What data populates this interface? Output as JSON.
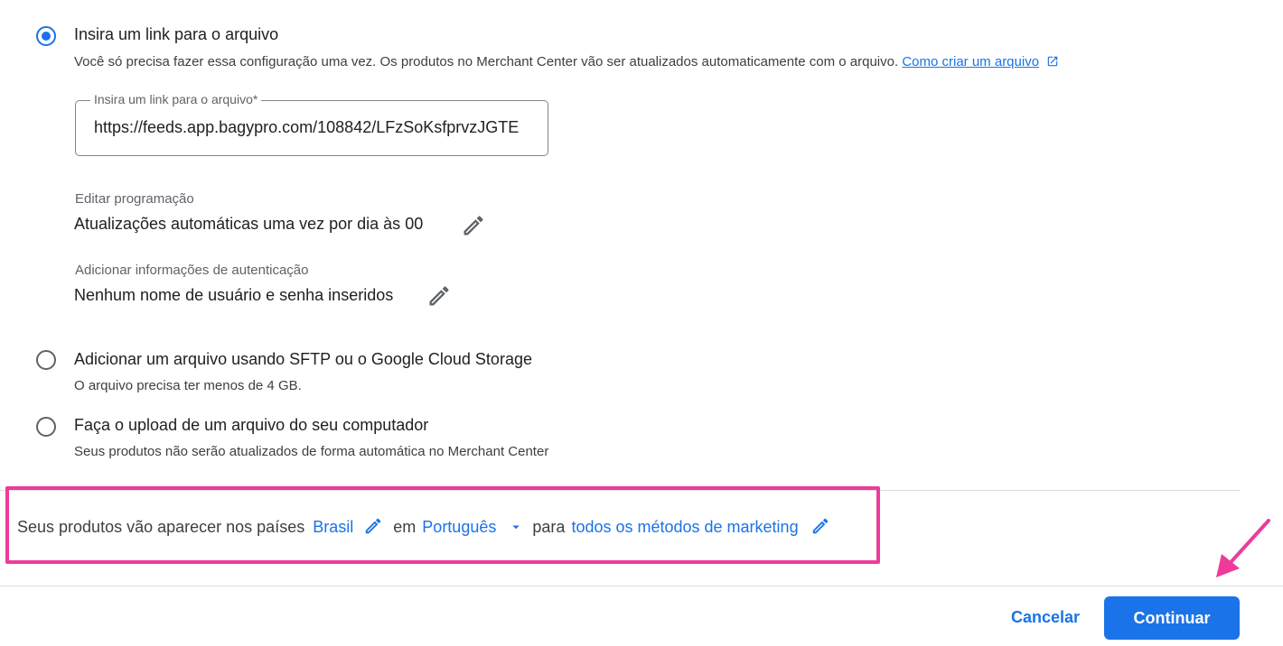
{
  "options": [
    {
      "label": "Insira um link para o arquivo",
      "description": "Você só precisa fazer essa configuração uma vez. Os produtos no Merchant Center vão ser atualizados automaticamente com o arquivo.",
      "help_link": "Como criar um arquivo",
      "selected": true
    },
    {
      "label": "Adicionar um arquivo usando SFTP ou o Google Cloud Storage",
      "description": "O arquivo precisa ter menos de 4 GB.",
      "selected": false
    },
    {
      "label": "Faça o upload de um arquivo do seu computador",
      "description": "Seus produtos não serão atualizados de forma automática no Merchant Center",
      "selected": false
    }
  ],
  "link_field": {
    "label": "Insira um link para o arquivo*",
    "value": "https://feeds.app.bagypro.com/108842/LFzSoKsfprvzJGTE"
  },
  "schedule": {
    "label": "Editar programação",
    "value": "Atualizações automáticas uma vez por dia às 00"
  },
  "auth": {
    "label": "Adicionar informações de autenticação",
    "value": "Nenhum nome de usuário e senha inseridos"
  },
  "summary": {
    "prefix": "Seus produtos vão aparecer nos países",
    "country": "Brasil",
    "in": "em",
    "language": "Português",
    "for": "para",
    "destination": "todos os métodos de marketing"
  },
  "footer": {
    "cancel": "Cancelar",
    "continue": "Continuar"
  },
  "colors": {
    "accent": "#1a73e8",
    "highlight": "#ee3b9a"
  }
}
